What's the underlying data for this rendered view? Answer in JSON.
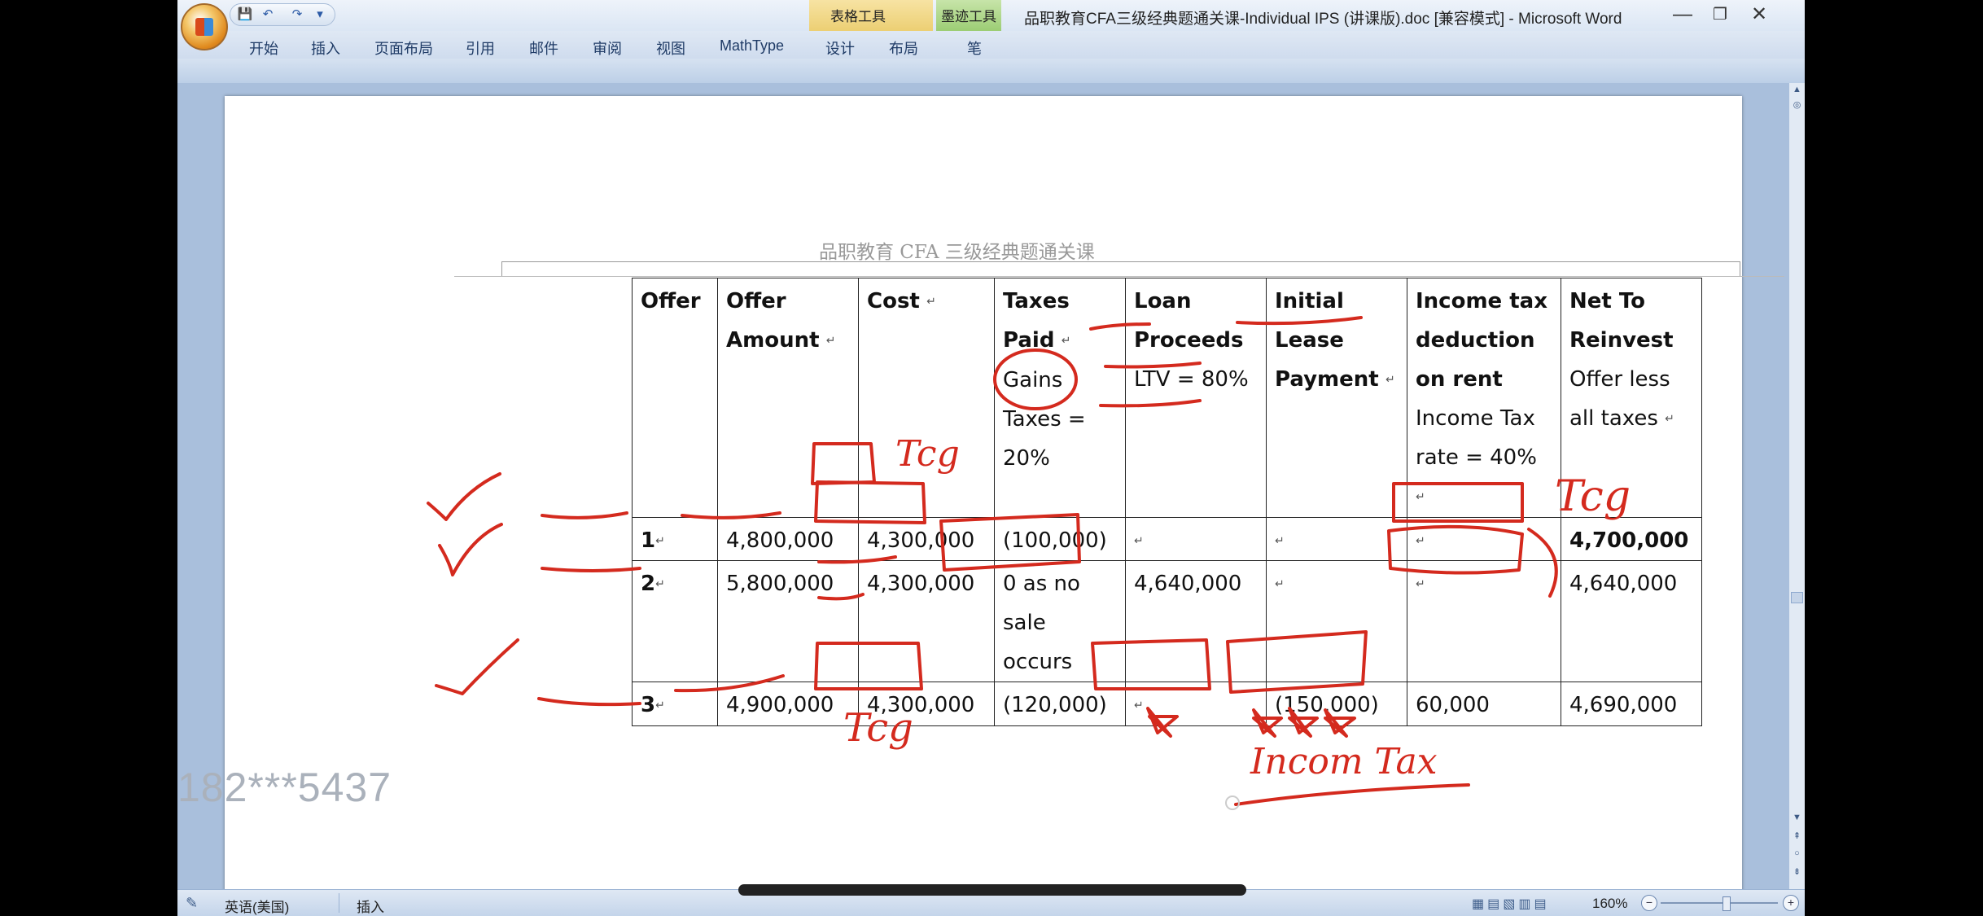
{
  "window": {
    "title": "品职教育CFA三级经典题通关课-Individual IPS (讲课版).doc [兼容模式] - Microsoft Word",
    "controls": {
      "minimize": "—",
      "restore": "❐",
      "close": "✕"
    }
  },
  "quick_access": {
    "save": "💾",
    "undo": "↶",
    "redo": "↷",
    "more": "▾"
  },
  "contextual_tabs": {
    "table_tools": "表格工具",
    "ink_tools": "墨迹工具"
  },
  "ribbon_tabs": [
    "开始",
    "插入",
    "页面布局",
    "引用",
    "邮件",
    "审阅",
    "视图",
    "MathType",
    "设计",
    "布局",
    "笔"
  ],
  "help": "?",
  "document": {
    "header": "品职教育  CFA 三级经典题通关课",
    "table": {
      "headers": [
        {
          "title": "Offer",
          "note": ""
        },
        {
          "title": "Offer Amount",
          "note": ""
        },
        {
          "title": "Cost",
          "note": ""
        },
        {
          "title": "Taxes Paid",
          "note": "Gains Taxes = 20%"
        },
        {
          "title": "Loan Proceeds",
          "note": "LTV = 80%"
        },
        {
          "title": "Initial Lease Payment",
          "note": ""
        },
        {
          "title": "Income tax deduction on rent",
          "note": "Income Tax rate = 40%"
        },
        {
          "title": "Net To Reinvest",
          "note": "Offer less all taxes"
        }
      ],
      "rows": [
        [
          "1",
          "4,800,000",
          "4,300,000",
          "(100,000)",
          "",
          "",
          "",
          "4,700,000"
        ],
        [
          "2",
          "5,800,000",
          "4,300,000",
          "0 as no sale occurs",
          "4,640,000",
          "",
          "",
          "4,640,000"
        ],
        [
          "3",
          "4,900,000",
          "4,300,000",
          "(120,000)",
          "",
          "(150,000)",
          "60,000",
          "4,690,000"
        ]
      ]
    }
  },
  "annotations": {
    "tcg_1": "Tcg",
    "tcg_2": "Tcg",
    "tcg_3": "Tcg",
    "income_tax": "Incom Tax"
  },
  "watermark": "182***5437",
  "status_bar": {
    "language": "英语(美国)",
    "mode": "插入",
    "zoom": "160%",
    "zoom_minus": "−",
    "zoom_plus": "+"
  },
  "colors": {
    "ink": "#d42a1e",
    "ribbon": "#cfdcee",
    "workspace": "#a9bfdc"
  }
}
